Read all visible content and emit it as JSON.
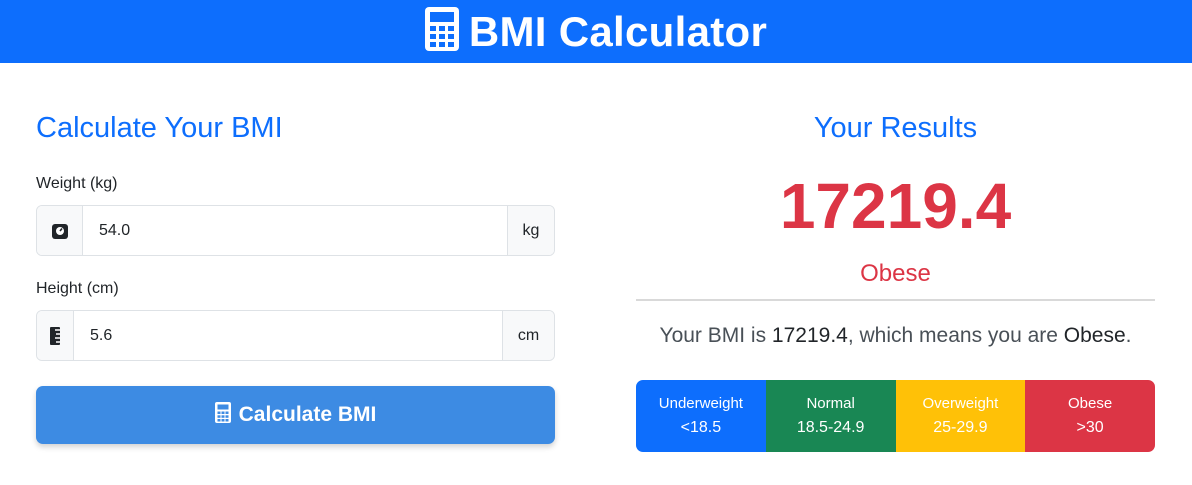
{
  "header": {
    "title": "BMI Calculator",
    "icon": "calculator-icon",
    "background": "#0d6efd"
  },
  "form": {
    "title": "Calculate Your BMI",
    "weight": {
      "label": "Weight (kg)",
      "value": "54.0",
      "unit": "kg",
      "icon": "weight-scale-icon"
    },
    "height": {
      "label": "Height (cm)",
      "value": "5.6",
      "unit": "cm",
      "icon": "ruler-icon"
    },
    "button_label": "Calculate BMI",
    "button_icon": "calculator-icon",
    "button_color": "#3d8be3"
  },
  "results": {
    "title": "Your Results",
    "bmi": "17219.4",
    "category": "Obese",
    "category_color": "#dc3545",
    "sentence_prefix": "Your BMI is ",
    "sentence_bmi": "17219.4",
    "sentence_middle": ", which means you are ",
    "sentence_category": "Obese",
    "sentence_suffix": "."
  },
  "scale": [
    {
      "label": "Underweight",
      "range": "<18.5",
      "color": "#0d6efd"
    },
    {
      "label": "Normal",
      "range": "18.5-24.9",
      "color": "#198754"
    },
    {
      "label": "Overweight",
      "range": "25-29.9",
      "color": "#ffc107"
    },
    {
      "label": "Obese",
      "range": ">30",
      "color": "#dc3545"
    }
  ]
}
